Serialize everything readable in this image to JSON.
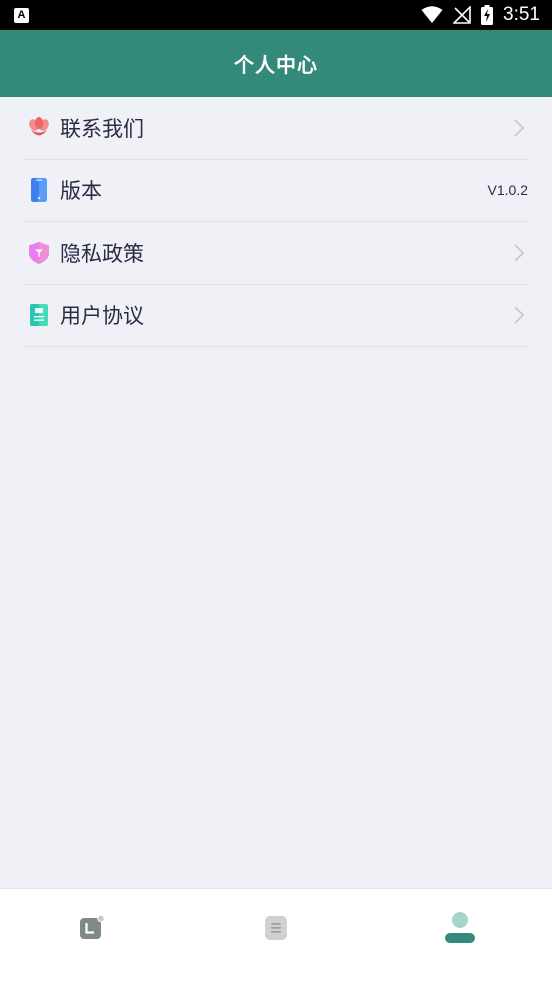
{
  "status_bar": {
    "time": "3:51",
    "notification_icon": "a-icon"
  },
  "header": {
    "title": "个人中心",
    "color": "#338a7a"
  },
  "menu": {
    "items": [
      {
        "label": "联系我们",
        "icon": "flower-icon",
        "icon_color": "#f06c6c",
        "has_arrow": true
      },
      {
        "label": "版本",
        "icon": "phone-icon",
        "icon_color": "#4b8cf0",
        "value": "V1.0.2"
      },
      {
        "label": "隐私政策",
        "icon": "shield-icon",
        "icon_color": "#e66bf2",
        "has_arrow": true
      },
      {
        "label": "用户协议",
        "icon": "document-icon",
        "icon_color": "#2fd1b0",
        "has_arrow": true
      }
    ]
  },
  "tab_bar": {
    "tabs": [
      {
        "icon": "clock-icon",
        "active": false
      },
      {
        "icon": "list-icon",
        "active": false
      },
      {
        "icon": "user-icon",
        "active": true
      }
    ]
  }
}
